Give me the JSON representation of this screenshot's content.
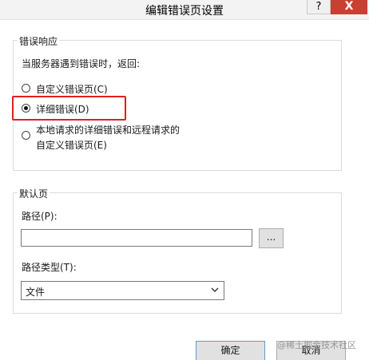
{
  "window": {
    "title": "编辑错误页设置",
    "help_label": "?",
    "close_label": "X"
  },
  "error_response": {
    "group_title": "错误响应",
    "prompt": "当服务器遇到错误时，返回:",
    "options": [
      {
        "label": "自定义错误页(C)",
        "selected": false
      },
      {
        "label": "详细错误(D)",
        "selected": true
      },
      {
        "label_line1": "本地请求的详细错误和远程请求的",
        "label_line2": "自定义错误页(E)",
        "selected": false
      }
    ]
  },
  "default_page": {
    "group_title": "默认页",
    "path_label": "路径(P):",
    "path_value": "",
    "browse_label": "...",
    "path_type_label": "路径类型(T):",
    "path_type_value": "文件"
  },
  "footer": {
    "ok_label": "确定",
    "cancel_label": "取消"
  },
  "watermark": "@稀土掘金技术社区",
  "colors": {
    "highlight": "#e02020",
    "close_button": "#c84031"
  }
}
